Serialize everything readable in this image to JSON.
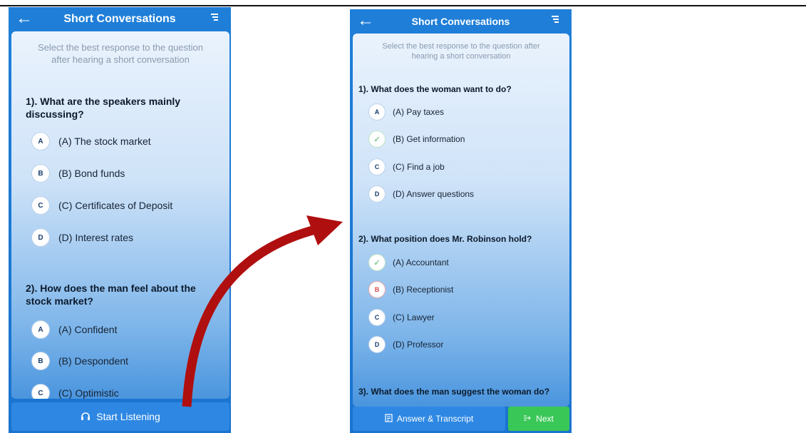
{
  "left": {
    "title": "Short Conversations",
    "instructions": "Select the best response to the question after hearing a short conversation",
    "questions": [
      {
        "text": "1). What are the speakers mainly discussing?",
        "options": [
          {
            "badge": "A",
            "label": "(A) The stock market"
          },
          {
            "badge": "B",
            "label": "(B) Bond funds"
          },
          {
            "badge": "C",
            "label": "(C) Certificates of Deposit"
          },
          {
            "badge": "D",
            "label": "(D) Interest rates"
          }
        ]
      },
      {
        "text": "2). How does the man feel about the stock market?",
        "options": [
          {
            "badge": "A",
            "label": "(A) Confident"
          },
          {
            "badge": "B",
            "label": "(B) Despondent"
          },
          {
            "badge": "C",
            "label": "(C) Optimistic"
          }
        ]
      }
    ],
    "start_button": "Start Listening"
  },
  "right": {
    "title": "Short Conversations",
    "instructions": "Select the best response to the question after hearing a short conversation",
    "questions": [
      {
        "text": "1). What does the woman want to do?",
        "options": [
          {
            "badge": "A",
            "label": "(A) Pay taxes",
            "state": "normal"
          },
          {
            "badge": "✓",
            "label": "(B) Get information",
            "state": "correct"
          },
          {
            "badge": "C",
            "label": "(C) Find a job",
            "state": "normal"
          },
          {
            "badge": "D",
            "label": "(D) Answer questions",
            "state": "normal"
          }
        ]
      },
      {
        "text": "2). What position does Mr. Robinson hold?",
        "options": [
          {
            "badge": "✓",
            "label": "(A) Accountant",
            "state": "correct"
          },
          {
            "badge": "B",
            "label": "(B) Receptionist",
            "state": "wrong"
          },
          {
            "badge": "C",
            "label": "(C) Lawyer",
            "state": "normal"
          },
          {
            "badge": "D",
            "label": "(D) Professor",
            "state": "normal"
          }
        ]
      },
      {
        "text": "3). What does the man suggest the woman do?"
      }
    ],
    "answer_button": "Answer & Transcript",
    "next_button": "Next"
  },
  "colors": {
    "header_blue": "#1f7fd8",
    "button_blue": "#2e88e3",
    "next_green": "#39c757",
    "arrow_red": "#b00f0f",
    "correct_green": "#7ac58d",
    "wrong_red": "#d84b4b"
  },
  "icons": {
    "back": "arrow-left-icon",
    "menu": "menu-icon",
    "headphones": "headphones-icon",
    "document": "document-icon",
    "next": "next-icon",
    "check": "check-icon"
  }
}
